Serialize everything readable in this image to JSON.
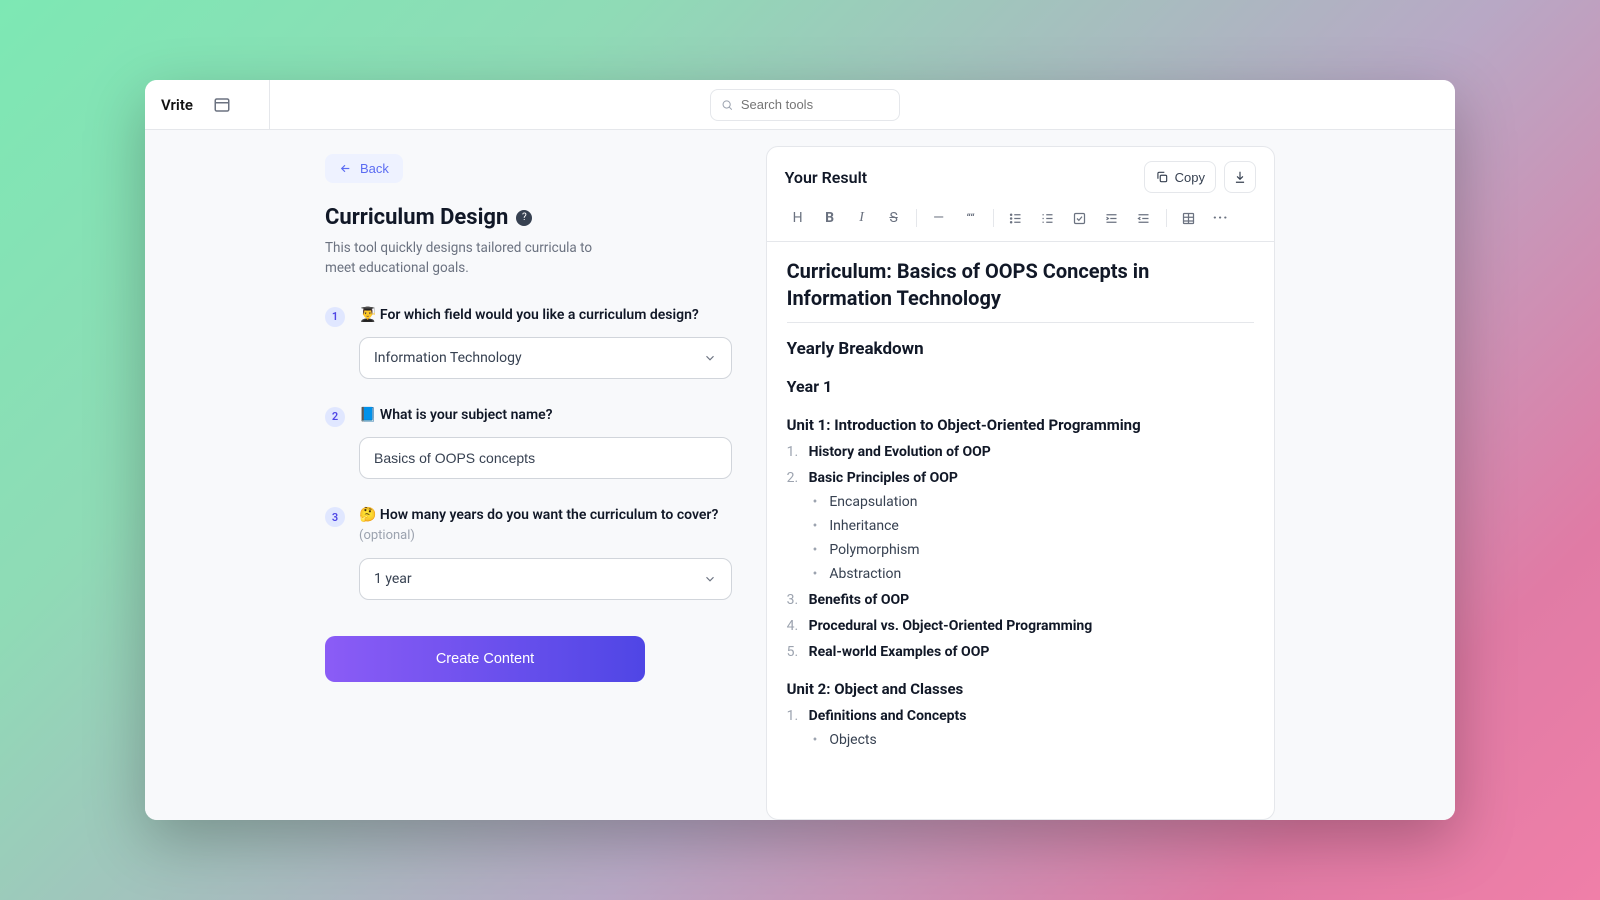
{
  "topbar": {
    "brand": "Vrite",
    "search_placeholder": "Search tools"
  },
  "left": {
    "back_label": "Back",
    "title": "Curriculum Design",
    "description": "This tool quickly designs tailored curricula to meet educational goals.",
    "step1": {
      "num": "1",
      "label": "👨‍🎓 For which field would you like a curriculum design?",
      "value": "Information Technology"
    },
    "step2": {
      "num": "2",
      "label": "📘 What is your subject name?",
      "value": "Basics of OOPS concepts"
    },
    "step3": {
      "num": "3",
      "label": "🤔 How many years do you want the curriculum to cover?",
      "optional": "(optional)",
      "value": "1 year"
    },
    "create_label": "Create Content"
  },
  "result": {
    "heading": "Your Result",
    "copy_label": "Copy",
    "toolbar": {
      "h": "H",
      "b": "B",
      "i": "I",
      "s": "S",
      "hr": "—",
      "quote": "““",
      "more": "···"
    }
  },
  "doc": {
    "title": "Curriculum: Basics of OOPS Concepts in Information Technology",
    "breakdown": "Yearly Breakdown",
    "year": "Year 1",
    "unit1": {
      "title": "Unit 1: Introduction to Object-Oriented Programming",
      "i1": "History and Evolution of OOP",
      "i2": "Basic Principles of OOP",
      "s1": "Encapsulation",
      "s2": "Inheritance",
      "s3": "Polymorphism",
      "s4": "Abstraction",
      "i3": "Benefits of OOP",
      "i4": "Procedural vs. Object-Oriented Programming",
      "i5": "Real-world Examples of OOP"
    },
    "unit2": {
      "title": "Unit 2: Object and Classes",
      "i1": "Definitions and Concepts",
      "s1": "Objects"
    }
  }
}
